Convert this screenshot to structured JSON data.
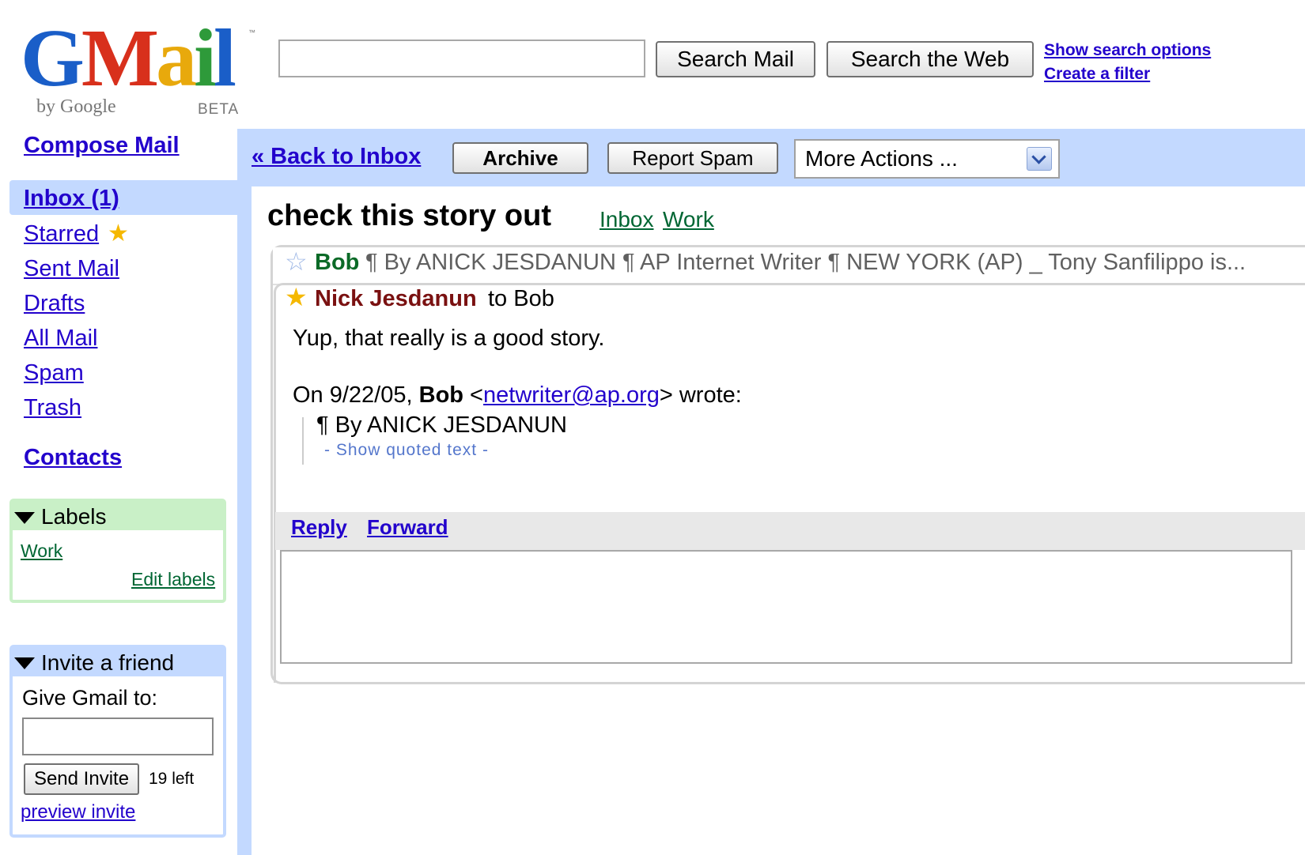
{
  "logo": {
    "letters": [
      "G",
      "M",
      "a",
      "i",
      "l"
    ],
    "tm": "™",
    "by_google": "by Google",
    "beta": "BETA"
  },
  "search": {
    "value": "",
    "search_mail": "Search Mail",
    "search_web": "Search the Web",
    "show_options": "Show search options",
    "create_filter": "Create a filter"
  },
  "nav": {
    "compose": "Compose Mail",
    "inbox": "Inbox (1)",
    "starred": "Starred",
    "sent": "Sent Mail",
    "drafts": "Drafts",
    "all": "All Mail",
    "spam": "Spam",
    "trash": "Trash",
    "contacts": "Contacts"
  },
  "labels": {
    "title": "Labels",
    "items": [
      "Work"
    ],
    "edit": "Edit labels"
  },
  "invite": {
    "title": "Invite a friend",
    "give": "Give Gmail to:",
    "send": "Send Invite",
    "left": "19 left",
    "preview": "preview invite"
  },
  "toolbar": {
    "back": "« Back to Inbox",
    "archive": "Archive",
    "report_spam": "Report Spam",
    "more_actions": "More Actions ..."
  },
  "thread": {
    "subject": "check this story out",
    "labels": [
      "Inbox",
      "Work"
    ],
    "collapsed": {
      "sender": "Bob",
      "snippet": "¶ By ANICK JESDANUN ¶ AP Internet Writer ¶ NEW YORK (AP) _ Tony Sanfilippo is..."
    },
    "message": {
      "sender": "Nick Jesdanun",
      "to": "to Bob",
      "body": "Yup, that really is a good story.",
      "quote_prefix": "On 9/22/05, ",
      "quote_name": "Bob",
      "quote_email": "netwriter@ap.org",
      "quote_suffix": "> wrote:",
      "quoted_text": "¶   By ANICK JESDANUN",
      "show_quoted": "- Show quoted text -"
    },
    "reply": "Reply",
    "forward": "Forward"
  },
  "colors": {
    "link": "#2200cc",
    "nav_highlight": "#c3d9ff",
    "labels_box": "#c9f0c7",
    "label_text": "#006633"
  }
}
